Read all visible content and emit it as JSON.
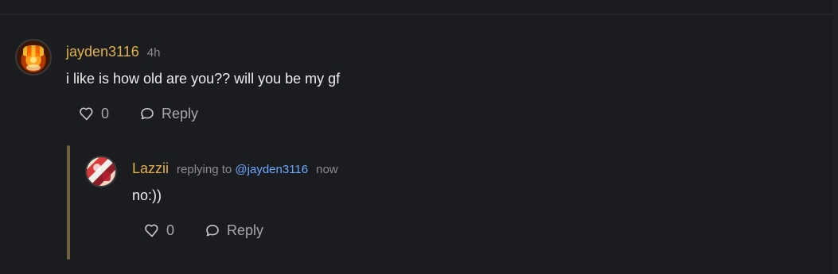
{
  "comment_main": {
    "username": "jayden3116",
    "time": "4h",
    "text": "i like is how old are you?? will you be my gf",
    "like_count": "0",
    "reply_label": "Reply",
    "avatar_icon": "flame-avatar"
  },
  "comment_reply": {
    "username": "Lazzii",
    "replying_prefix": "replying to",
    "replying_handle": "@jayden3116",
    "time": "now",
    "text": "no:))",
    "like_count": "0",
    "reply_label": "Reply",
    "avatar_icon": "anime-avatar"
  },
  "icons": {
    "like": "heart-icon",
    "reply": "speech-bubble-icon"
  },
  "colors": {
    "background": "#1b1c20",
    "username": "#e2b24b",
    "mention": "#6da8ff",
    "thread_line": "#6f6040",
    "action_text": "#a9a9ad"
  }
}
